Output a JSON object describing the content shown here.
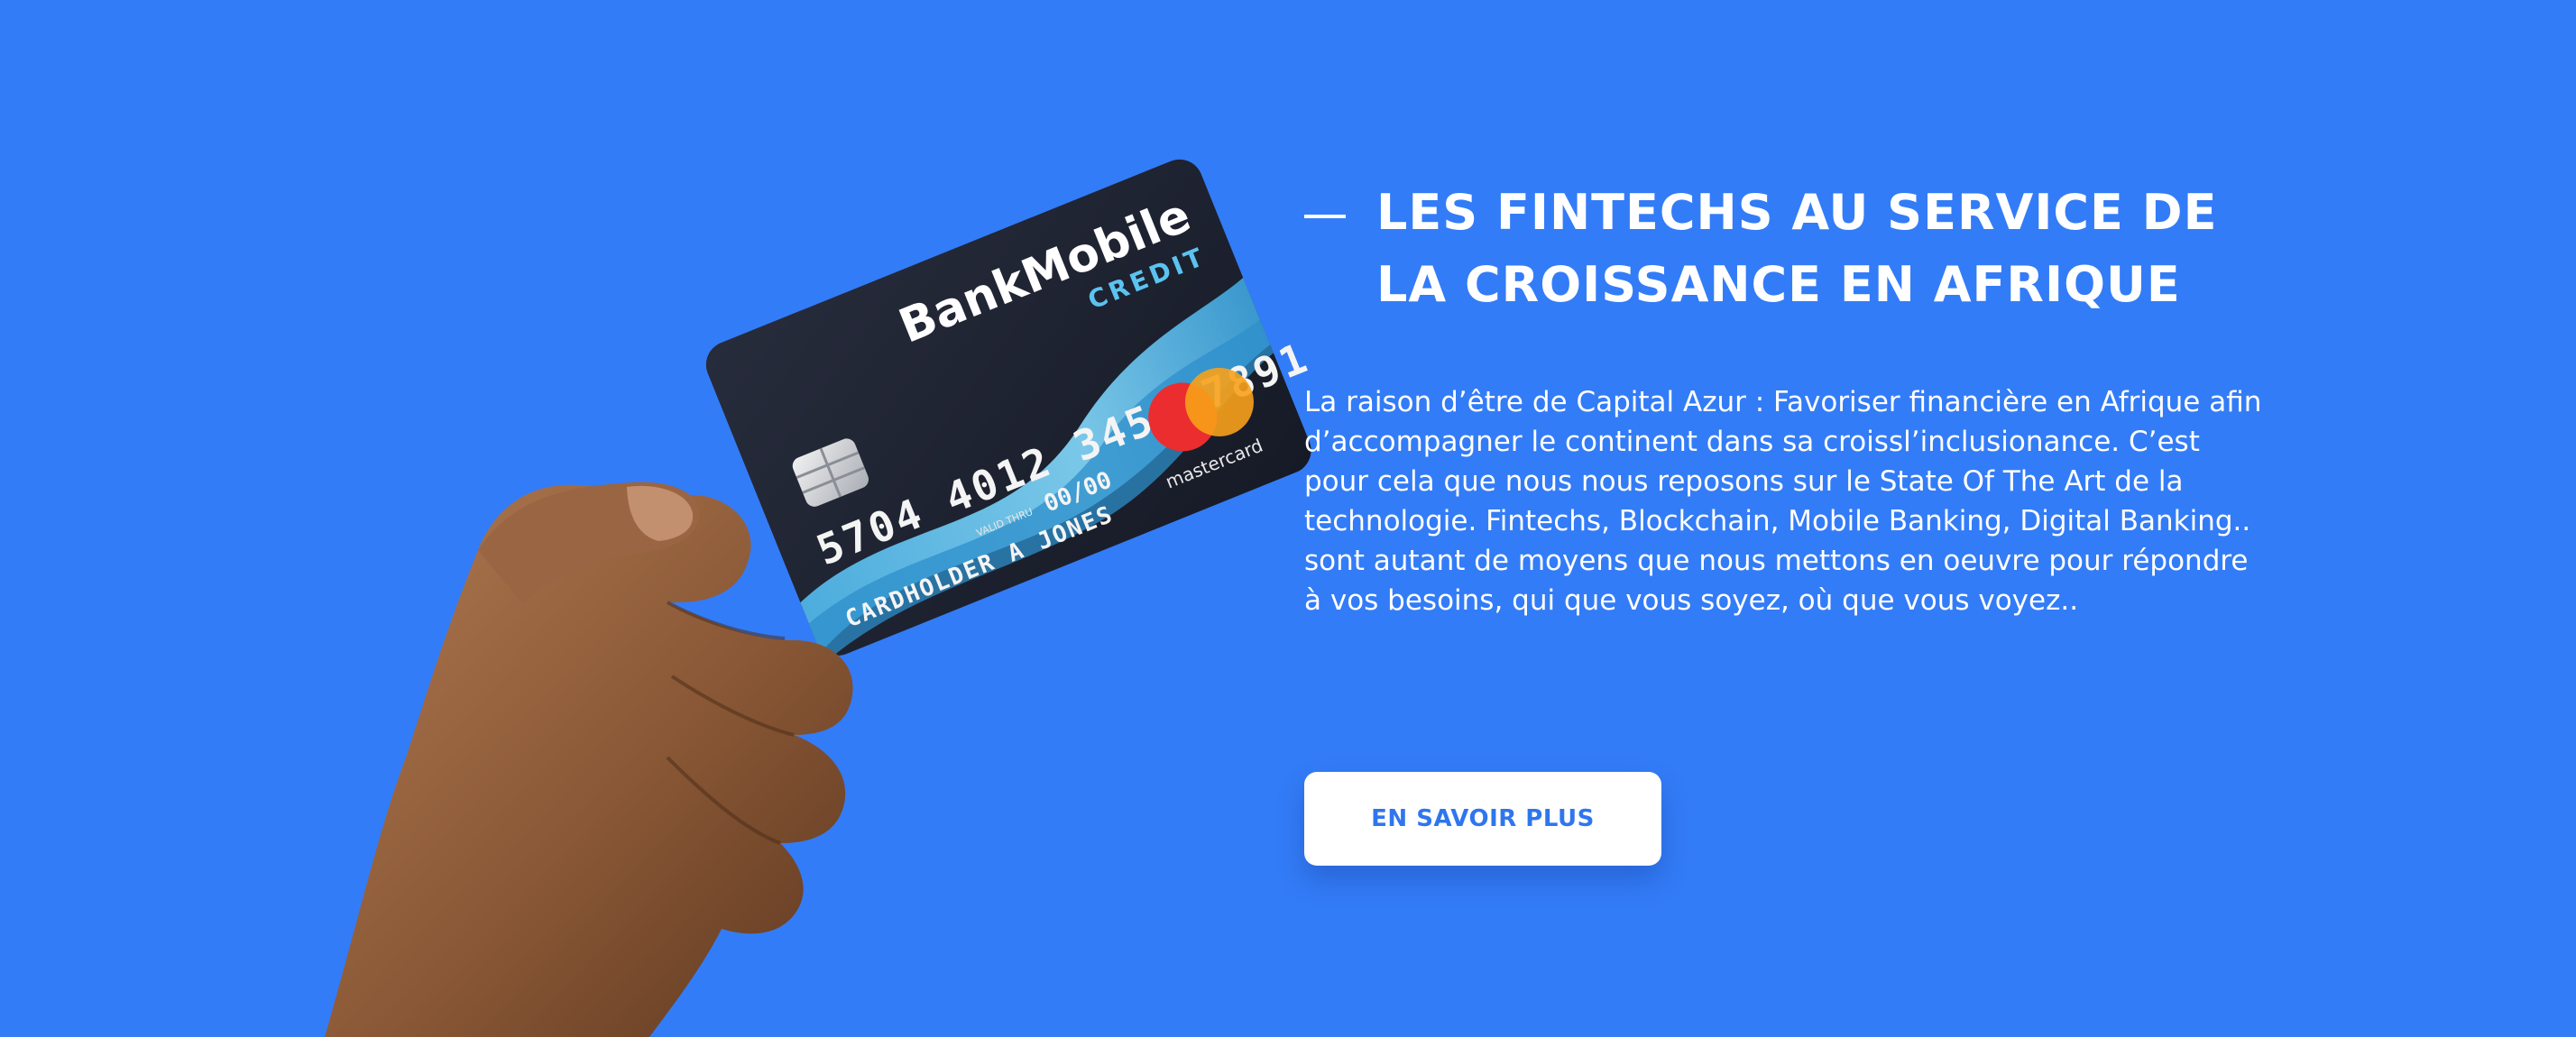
{
  "theme": {
    "background": "#337cf7",
    "text": "#ffffff",
    "button_text": "#2f76ee",
    "button_bg": "#ffffff"
  },
  "hero": {
    "heading_line1": "LES FINTECHS AU SERVICE DE",
    "heading_line2": "LA CROISSANCE EN AFRIQUE",
    "description": "La raison d’être de Capital Azur : Favoriser financière en Afrique afin d’accompagner le continent dans sa croissl’inclusionance. C’est pour cela que nous nous reposons sur le State Of The Art de la technologie. Fintechs, Blockchain, Mobile Banking, Digital Banking.. sont autant de moyens que nous mettons en oeuvre pour répondre à vos besoins, qui que vous soyez, où que vous voyez..",
    "cta_label": "EN SAVOIR PLUS"
  },
  "illustration": {
    "subject": "hand-holding-credit-card",
    "card": {
      "brand": "BankMobile",
      "type_label": "CREDIT",
      "number": "5704 4012 3456 7891",
      "expiry_caption": "VALID THRU",
      "expiry": "00/00",
      "holder": "CARDHOLDER A JONES",
      "network": "mastercard"
    }
  }
}
